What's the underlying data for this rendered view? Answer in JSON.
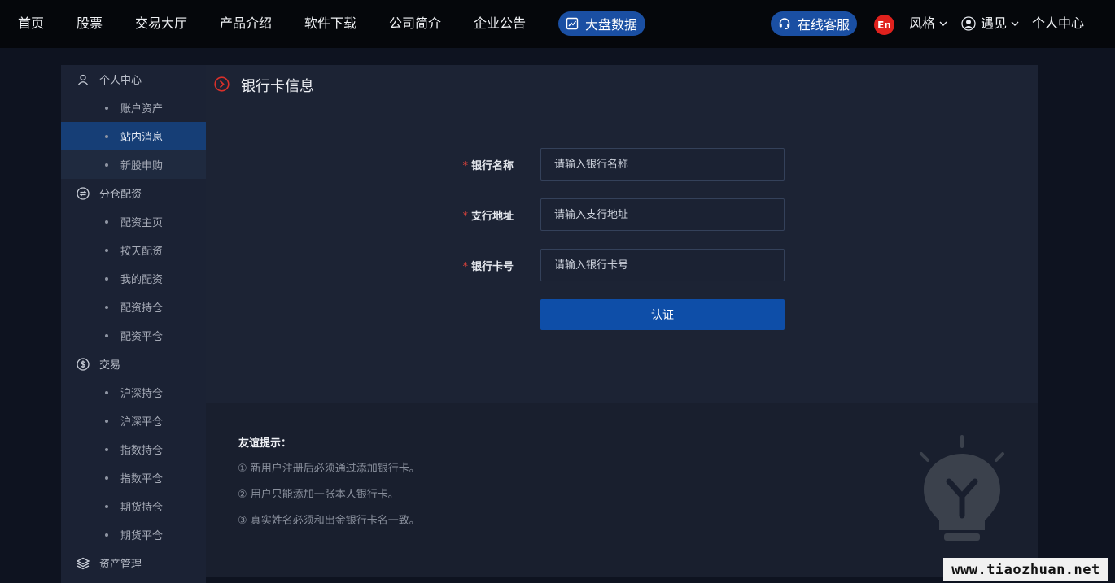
{
  "nav": {
    "items": [
      "首页",
      "股票",
      "交易大厅",
      "产品介绍",
      "软件下载",
      "公司简介",
      "企业公告"
    ],
    "big_data": "大盘数据",
    "service": "在线客服",
    "lang": "En",
    "style": "风格",
    "user": "遇见",
    "personal_center": "个人中心"
  },
  "sidebar": {
    "groups": [
      {
        "title": "个人中心",
        "icon": "user-icon",
        "items": [
          "账户资产",
          "站内消息",
          "新股申购"
        ]
      },
      {
        "title": "分仓配资",
        "icon": "swap-icon",
        "items": [
          "配资主页",
          "按天配资",
          "我的配资",
          "配资持仓",
          "配资平仓"
        ]
      },
      {
        "title": "交易",
        "icon": "coin-icon",
        "items": [
          "沪深持仓",
          "沪深平仓",
          "指数持仓",
          "指数平仓",
          "期货持仓",
          "期货平仓"
        ]
      },
      {
        "title": "资产管理",
        "icon": "layers-icon",
        "items": []
      }
    ]
  },
  "main": {
    "title": "银行卡信息",
    "form": {
      "bank_name_label": "银行名称",
      "bank_name_placeholder": "请输入银行名称",
      "branch_label": "支行地址",
      "branch_placeholder": "请输入支行地址",
      "card_no_label": "银行卡号",
      "card_no_placeholder": "请输入银行卡号",
      "submit": "认证",
      "required_mark": "*"
    },
    "tips": {
      "title": "友谊提示：",
      "lines": [
        "① 新用户注册后必须通过添加银行卡。",
        "② 用户只能添加一张本人银行卡。",
        "③ 真实姓名必须和出金银行卡名一致。"
      ]
    }
  },
  "watermark": "www.tiaozhuan.net",
  "colors": {
    "accent": "#0e4ea8",
    "pill": "#1a4fa3",
    "lang_badge": "#e0211d",
    "required": "#e0443b",
    "active_item": "#163e76"
  }
}
